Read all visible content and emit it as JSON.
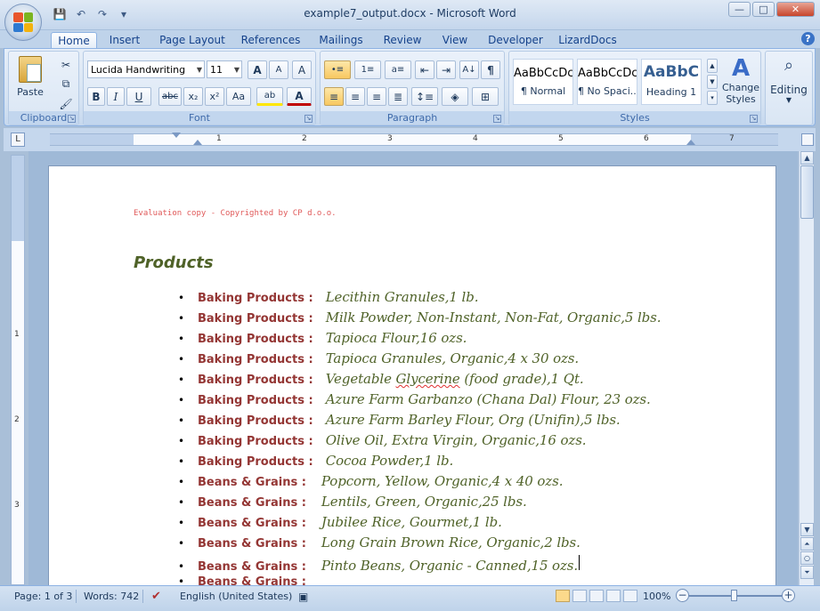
{
  "window": {
    "title": "example7_output.docx - Microsoft Word",
    "controls": {
      "minimize": "—",
      "maximize": "□",
      "close": "✕"
    }
  },
  "qat": {
    "save_icon": "💾",
    "undo_icon": "↶",
    "redo_icon": "↷",
    "customize_icon": "▾"
  },
  "tabs": [
    {
      "label": "Home",
      "active": true
    },
    {
      "label": "Insert"
    },
    {
      "label": "Page Layout"
    },
    {
      "label": "References"
    },
    {
      "label": "Mailings"
    },
    {
      "label": "Review"
    },
    {
      "label": "View"
    },
    {
      "label": "Developer"
    },
    {
      "label": "LizardDocs"
    }
  ],
  "help_icon": "?",
  "ribbon": {
    "clipboard": {
      "label": "Clipboard",
      "paste": "Paste"
    },
    "font": {
      "label": "Font",
      "family": "Lucida Handwriting",
      "size": "11",
      "grow": "A",
      "shrink": "A",
      "clear": "A",
      "bold": "B",
      "italic": "I",
      "underline": "U",
      "strike": "abc",
      "subscript": "x₂",
      "superscript": "x²",
      "change_case": "Aa",
      "highlight": "ab",
      "font_color": "A"
    },
    "paragraph": {
      "label": "Paragraph",
      "show_marks": "¶"
    },
    "styles": {
      "label": "Styles",
      "items": [
        {
          "sample": "AaBbCcDc",
          "name": "¶ Normal"
        },
        {
          "sample": "AaBbCcDc",
          "name": "¶ No Spaci..."
        },
        {
          "sample": "AaBbC",
          "name": "Heading 1"
        }
      ],
      "change_styles": "Change Styles"
    },
    "editing": {
      "label": "Editing"
    }
  },
  "ruler": {
    "numbers": [
      "1",
      "2",
      "3",
      "4",
      "5",
      "6",
      "7"
    ],
    "vnumbers": [
      "1",
      "2",
      "3"
    ],
    "corner": "L"
  },
  "document": {
    "eval_notice": "Evaluation copy - Copyrighted by CP d.o.o.",
    "heading": "Products",
    "items": [
      {
        "category": "Baking Products :",
        "text": "Lecithin Granules,1 lb."
      },
      {
        "category": "Baking Products :",
        "text": "Milk Powder, Non-Instant, Non-Fat, Organic,5 lbs."
      },
      {
        "category": "Baking Products :",
        "text": "Tapioca Flour,16 ozs."
      },
      {
        "category": "Baking Products :",
        "text": "Tapioca Granules, Organic,4 x 30 ozs."
      },
      {
        "category": "Baking Products :",
        "text": "Vegetable Glycerine (food grade),1 Qt."
      },
      {
        "category": "Baking Products :",
        "text": "Azure Farm Garbanzo (Chana Dal) Flour, 23 ozs."
      },
      {
        "category": "Baking Products :",
        "text": "Azure Farm Barley Flour, Org (Unifin),5 lbs."
      },
      {
        "category": "Baking Products :",
        "text": "Olive Oil, Extra Virgin, Organic,16 ozs."
      },
      {
        "category": "Baking Products :",
        "text": "Cocoa Powder,1 lb."
      },
      {
        "category": "Beans & Grains :",
        "text": "Popcorn, Yellow, Organic,4 x 40 ozs."
      },
      {
        "category": "Beans & Grains :",
        "text": "Lentils, Green, Organic,25 lbs."
      },
      {
        "category": "Beans & Grains :",
        "text": "Jubilee Rice, Gourmet,1 lb."
      },
      {
        "category": "Beans & Grains :",
        "text": "Long Grain Brown Rice, Organic,2 lbs."
      },
      {
        "category": "Beans & Grains :",
        "text": "Pinto Beans, Organic - Canned,15 ozs."
      },
      {
        "category": "Beans & Grains :",
        "text": ""
      }
    ]
  },
  "statusbar": {
    "page": "Page: 1 of 3",
    "words": "Words: 742",
    "language": "English (United States)",
    "zoom": "100%",
    "zoom_out": "−",
    "zoom_in": "+"
  },
  "colors": {
    "category": "#943634",
    "item": "#4f6228",
    "heading": "#4f6228",
    "eval": "#e05a5a"
  }
}
